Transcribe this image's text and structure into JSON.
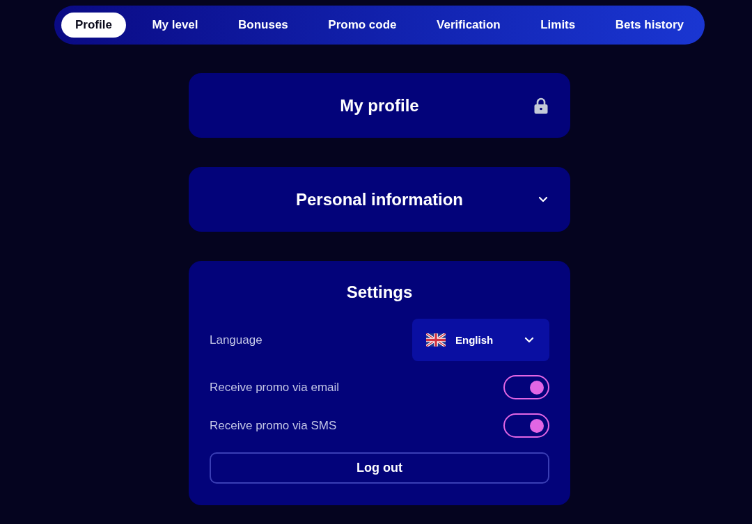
{
  "tabs": [
    {
      "label": "Profile",
      "selected": true
    },
    {
      "label": "My level",
      "selected": false
    },
    {
      "label": "Bonuses",
      "selected": false
    },
    {
      "label": "Promo code",
      "selected": false
    },
    {
      "label": "Verification",
      "selected": false
    },
    {
      "label": "Limits",
      "selected": false
    },
    {
      "label": "Bets history",
      "selected": false
    }
  ],
  "sections": [
    {
      "title": "My profile",
      "kind": "locked"
    },
    {
      "title": "Personal information",
      "kind": "collapsible",
      "expanded": false
    }
  ],
  "settings": {
    "title": "Settings",
    "language": {
      "label": "Language",
      "value": "English"
    },
    "toggles": [
      {
        "label": "Receive promo via email",
        "on": true
      },
      {
        "label": "Receive promo via SMS",
        "on": true
      }
    ],
    "logout_button": "Log out"
  }
}
